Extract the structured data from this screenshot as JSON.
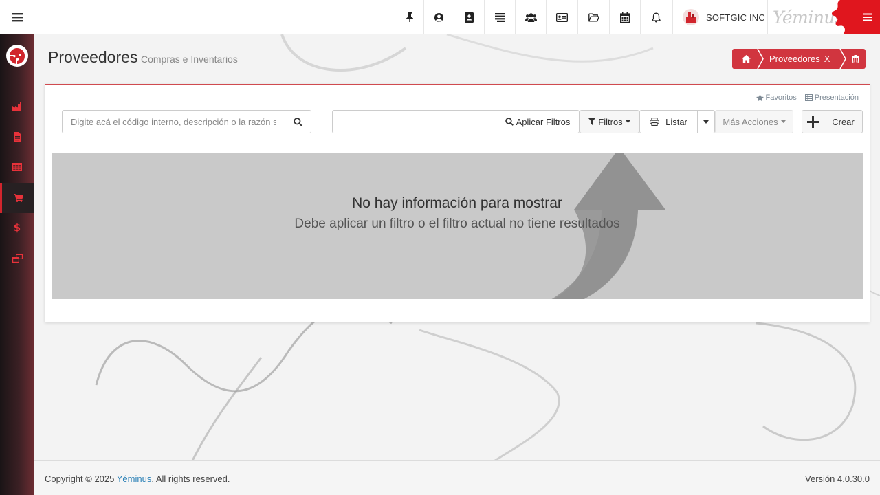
{
  "header": {
    "company_name": "SOFTGIC INC",
    "brand_name": "Yéminus",
    "top_icons": [
      "pin-icon",
      "user-circle-icon",
      "contact-book-icon",
      "list-icon",
      "users-icon",
      "id-card-icon",
      "folder-icon",
      "calendar-icon",
      "bell-icon"
    ]
  },
  "sidebar": {
    "items": [
      {
        "name": "industry-icon",
        "active": false
      },
      {
        "name": "document-icon",
        "active": false
      },
      {
        "name": "table-icon",
        "active": false
      },
      {
        "name": "cart-icon",
        "active": true
      },
      {
        "name": "dollar-icon",
        "active": false
      },
      {
        "name": "windows-icon",
        "active": false
      }
    ]
  },
  "page": {
    "title": "Proveedores",
    "subtitle": "Compras e Inventarios"
  },
  "breadcrumb": {
    "current": "Proveedores",
    "close": "X"
  },
  "panel": {
    "favorites_label": "Favoritos",
    "presentation_label": "Presentación",
    "search_placeholder": "Digite acá el código interno, descripción o la razón social",
    "filter_value": "",
    "apply_filters_label": "Aplicar Filtros",
    "filters_label": "Filtros",
    "list_label": "Listar",
    "more_actions_label": "Más Acciones",
    "create_label": "Crear"
  },
  "empty_state": {
    "title": "No hay información para mostrar",
    "message": "Debe aplicar un filtro o el filtro actual no tiene resultados"
  },
  "footer": {
    "copyright_prefix": "Copyright © 2025 ",
    "copyright_link": "Yéminus",
    "copyright_suffix": ". All rights reserved.",
    "version": "Versión 4.0.30.0"
  },
  "colors": {
    "accent": "#d1353f",
    "brand_red": "#e0161e",
    "link": "#2f83b8"
  }
}
